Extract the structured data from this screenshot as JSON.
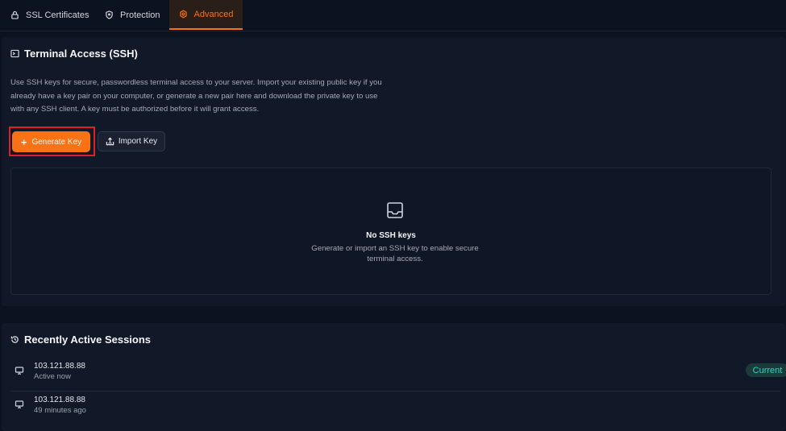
{
  "tabs": [
    {
      "label": "SSL Certificates",
      "icon": "lock-icon"
    },
    {
      "label": "Protection",
      "icon": "shield-icon"
    },
    {
      "label": "Advanced",
      "icon": "gear-icon",
      "active": true
    }
  ],
  "terminal": {
    "title": "Terminal Access (SSH)",
    "description": "Use SSH keys for secure, passwordless terminal access to your server. Import your existing public key if you already have a key pair on your computer, or generate a new pair here and download the private key to use with any SSH client. A key must be authorized before it will grant access.",
    "generate_label": "Generate Key",
    "import_label": "Import Key",
    "empty_title": "No SSH keys",
    "empty_subtitle": "Generate or import an SSH key to enable secure terminal access."
  },
  "sessions": {
    "title": "Recently Active Sessions",
    "items": [
      {
        "ip": "103.121.88.88",
        "time": "Active now",
        "badge": "Current"
      },
      {
        "ip": "103.121.88.88",
        "time": "49 minutes ago"
      }
    ]
  },
  "colors": {
    "accent": "#f97316",
    "current_badge": "#2dd4bf",
    "highlight": "#e11d2a"
  }
}
